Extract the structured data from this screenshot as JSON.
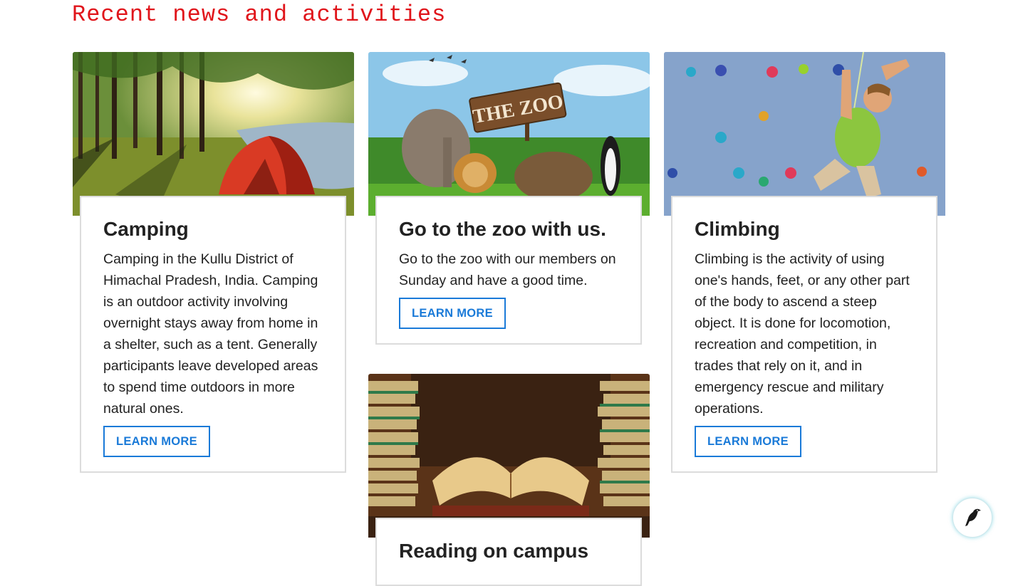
{
  "section": {
    "title": "Recent news and activities"
  },
  "cards": [
    {
      "title": "Camping",
      "text": "Camping in the Kullu District of Himachal Pradesh, India. Camping is an outdoor activity involving overnight stays away from home in a shelter, such as a tent. Generally participants leave developed areas to spend time outdoors in more natural ones.",
      "button": "LEARN MORE",
      "image_icon": "camping-photo"
    },
    {
      "title": "Go to the zoo with us.",
      "text": "Go to the zoo with our members on Sunday and have a good time.",
      "button": "LEARN MORE",
      "image_icon": "zoo-photo",
      "image_sign": "THE ZOO"
    },
    {
      "title": "Climbing",
      "text": "Climbing is the activity of using one's hands, feet, or any other part of the body to ascend a steep object. It is done for locomotion, recreation and competition, in trades that rely on it, and in emergency rescue and military operations.",
      "button": "LEARN MORE",
      "image_icon": "climbing-photo"
    },
    {
      "title": "Reading on campus",
      "image_icon": "books-photo"
    }
  ],
  "floating_button": {
    "icon": "bird-icon"
  },
  "colors": {
    "heading": "#e0151b",
    "accent": "#1a7ad8",
    "card_border": "#dcdcdc"
  }
}
